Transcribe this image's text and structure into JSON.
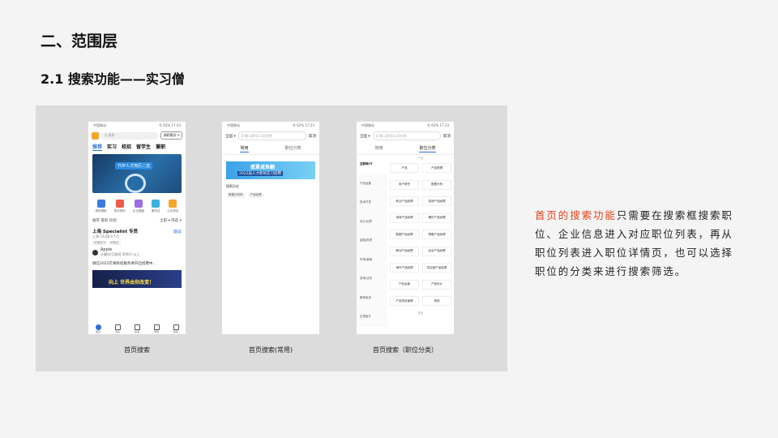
{
  "slide": {
    "title": "二、范围层",
    "subtitle": "2.1 搜索功能——实习僧"
  },
  "captions": [
    "首页搜索",
    "首页搜索(常用)",
    "首页搜索（职位分类）"
  ],
  "description": {
    "highlight": "首页的搜索功能",
    "rest": "只需要在搜索框搜索职位、企业信息进入对应职位列表，再从职位列表进入职位详情页，也可以选择职位的分类来进行搜索筛选。"
  },
  "phone1": {
    "status_left": "中国移动",
    "status_right": "令 62% 17:33",
    "search_placeholder": "Q 搜索",
    "resume_button": "求职简历 >",
    "tabs": [
      "推荐",
      "实习",
      "校招",
      "留学生",
      "兼职"
    ],
    "banner_text": "TOP人才简历二选",
    "icons": [
      {
        "label": "简历模板",
        "color": "#3d7be0"
      },
      {
        "label": "笔试资料",
        "color": "#ee5a4a"
      },
      {
        "label": "企业直播",
        "color": "#9a6ee0"
      },
      {
        "label": "服务站",
        "color": "#3bb0e0"
      },
      {
        "label": "公司排名",
        "color": "#f3a52c"
      }
    ],
    "section_left": "推荐  最新  校招",
    "section_right": "全职 ▾  筛选 ▾",
    "job": {
      "title": "上海 Specialist 专员",
      "pay": "面议",
      "meta": "上海  5天/周  6个月",
      "tags": [
        "日常实习",
        "可转正"
      ],
      "company": "Apple",
      "company_meta": "计算机/互联网  5000人以上"
    },
    "news": "微信2022芒果秋招服务季开启招聘中…",
    "banner2_text": "向上 世界由你改变！",
    "tabbar": [
      "首页",
      "消息",
      "投递",
      "学院",
      "我的"
    ]
  },
  "phone2": {
    "status_left": "中国移动",
    "status_right": "令 62% 17:33",
    "city": "全国 ▾",
    "search_placeholder": "Q 输入职位/公司名称",
    "cancel": "取消",
    "tabs": [
      "常用",
      "职位分类"
    ],
    "banner_line1": "盛夏咸鱼翻",
    "banner_line2": "2022届人才职场实习招聘",
    "history_label": "搜索历史",
    "history_chips": [
      "数据分析师",
      "产品经理"
    ]
  },
  "phone3": {
    "status_left": "中国移动",
    "status_right": "令 62% 17:33",
    "city": "全国 ▾",
    "search_placeholder": "Q 输入职位/公司名称",
    "cancel": "取消",
    "tabs": [
      "常用",
      "职位分类"
    ],
    "left_categories": [
      "互联网/IT",
      "产品运营",
      "技术开发",
      "设计/创意",
      "金融/投资",
      "市场/营销",
      "咨询/法务",
      "教育培训",
      "生物医疗"
    ],
    "right_head": "产品",
    "right_items": [
      "产品",
      "产品助理",
      "用户研究",
      "数据分析",
      "商业产品经理",
      "游戏产品经理",
      "电商产品经理",
      "硬件产品经理",
      "数据产品经理",
      "策略产品经理",
      "移动产品经理",
      "后台产品经理",
      "海外产品经理",
      "供应链产品经理",
      "产品运营",
      "产品设计",
      "产品项目管理",
      "其他"
    ],
    "right_foot": "更多"
  }
}
